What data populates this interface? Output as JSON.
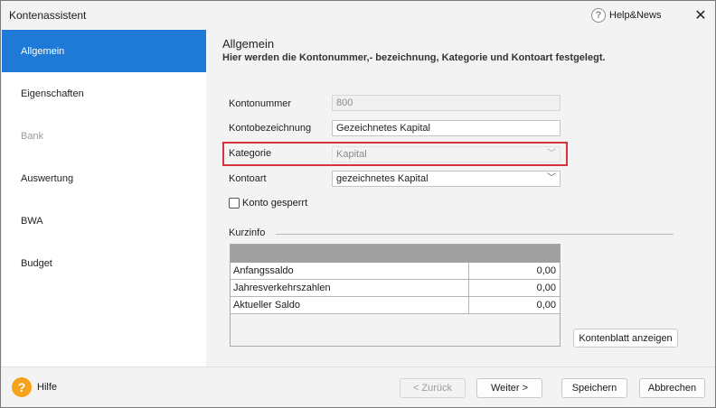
{
  "window": {
    "title": "Kontenassistent",
    "help_news": "Help&News",
    "close_glyph": "✕"
  },
  "sidebar": {
    "items": [
      {
        "label": "Allgemein",
        "state": "active"
      },
      {
        "label": "Eigenschaften",
        "state": "normal"
      },
      {
        "label": "Bank",
        "state": "disabled"
      },
      {
        "label": "Auswertung",
        "state": "normal"
      },
      {
        "label": "BWA",
        "state": "normal"
      },
      {
        "label": "Budget",
        "state": "normal"
      }
    ]
  },
  "main": {
    "heading": "Allgemein",
    "subheading": "Hier werden die Kontonummer,- bezeichnung, Kategorie und Kontoart festgelegt.",
    "fields": {
      "kontonummer": {
        "label": "Kontonummer",
        "value": "800"
      },
      "kontobezeichnung": {
        "label": "Kontobezeichnung",
        "value": "Gezeichnetes Kapital"
      },
      "kategorie": {
        "label": "Kategorie",
        "value": "Kapital"
      },
      "kontoart": {
        "label": "Kontoart",
        "value": "gezeichnetes Kapital"
      }
    },
    "konto_gesperrt": {
      "label": "Konto gesperrt",
      "checked": false
    },
    "kurzinfo": {
      "label": "Kurzinfo",
      "rows": [
        {
          "name": "Anfangssaldo",
          "value": "0,00"
        },
        {
          "name": "Jahresverkehrszahlen",
          "value": "0,00"
        },
        {
          "name": "Aktueller Saldo",
          "value": "0,00"
        }
      ]
    },
    "kontenblatt_button": "Kontenblatt anzeigen"
  },
  "footer": {
    "help_label": "Hilfe",
    "back_button": "< Zurück",
    "next_button": "Weiter >",
    "save_button": "Speichern",
    "cancel_button": "Abbrechen"
  },
  "colors": {
    "accent": "#1e7ad6",
    "highlight": "#d8323c",
    "help_icon": "#f7a21b"
  },
  "icons": {
    "help_news": "question-circle-icon",
    "help": "question-circle-filled-icon",
    "dropdown": "chevron-down-icon",
    "close": "close-icon"
  }
}
